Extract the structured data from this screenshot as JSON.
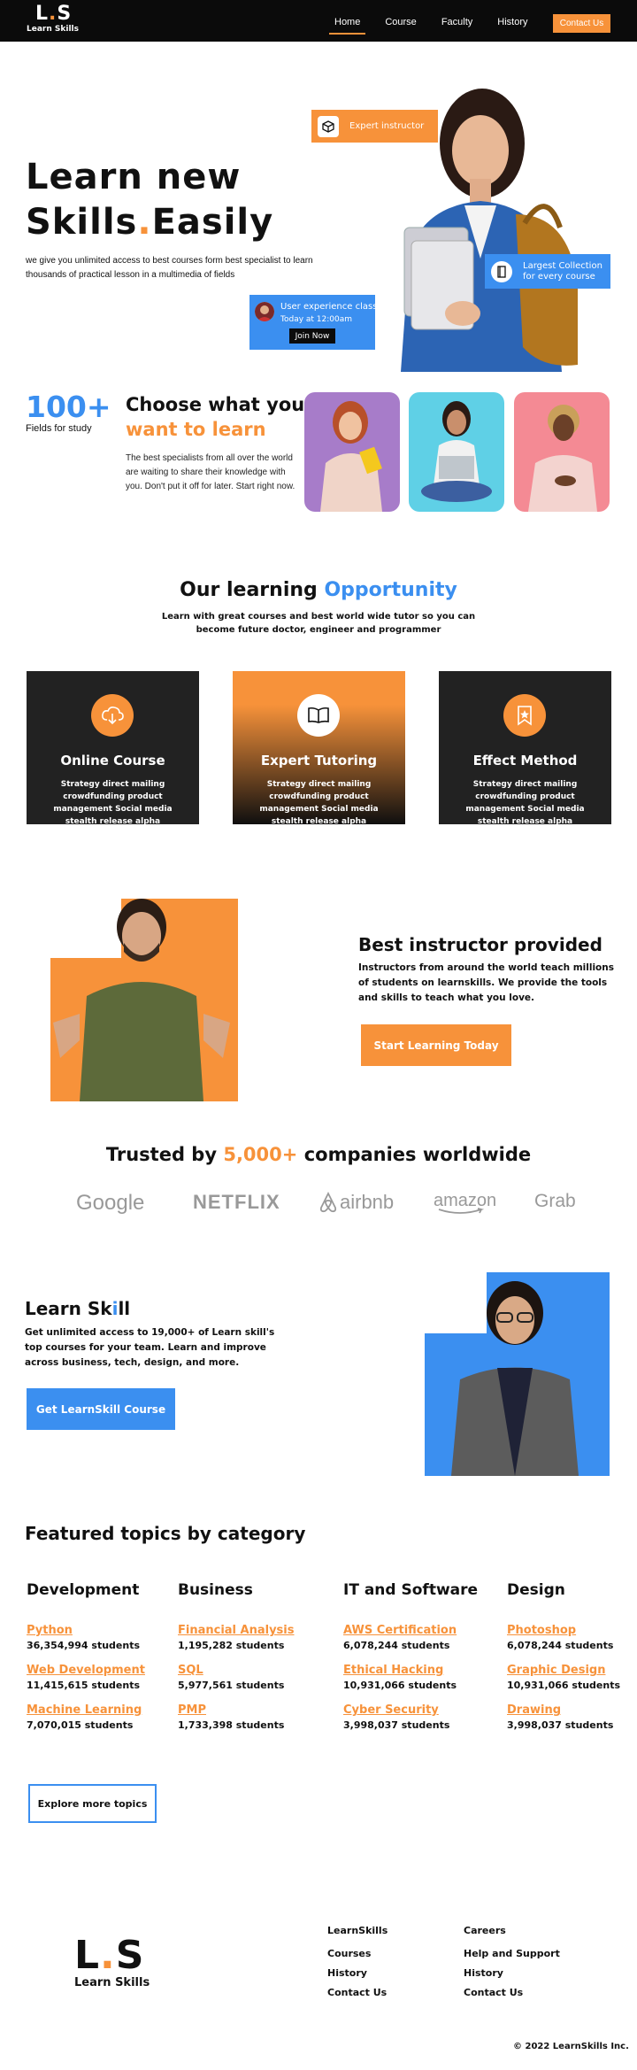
{
  "nav": {
    "logo_mark": "L",
    "logo_mark_end": "S",
    "logo_text": "Learn Skills",
    "links": [
      {
        "label": "Home",
        "active": true
      },
      {
        "label": "Course",
        "active": false
      },
      {
        "label": "Faculty",
        "active": false
      },
      {
        "label": "History",
        "active": false
      }
    ],
    "contact_label": "Contact Us"
  },
  "hero": {
    "title_line1": "Learn new",
    "title_word1": "Skills",
    "title_word2": "Easily",
    "description": "we give you unlimited access to best courses form best specialist to learn thousands of practical lesson in a multimedia of fields",
    "badge_expert": "Expert instructor",
    "badge_largest_line1": "Largest Collection",
    "badge_largest_line2": "for every course",
    "ux_title": "User experience class",
    "ux_time": "Today at 12:00am",
    "join_label": "Join Now"
  },
  "stats": {
    "number": "100+",
    "label": "Fields for study",
    "title_line1": "Choose what you",
    "title_line2": "want to learn",
    "description": "The best specialists from all over the world are waiting to share their knowledge with you. Don't put it off for later. Start right now."
  },
  "opportunity": {
    "title_a": "Our learning",
    "title_b": "Opportunity",
    "subtitle": "Learn with great courses and best world wide tutor so you can become future doctor, engineer and programmer",
    "cards": [
      {
        "title": "Online Course",
        "desc": "Strategy direct mailing crowdfunding product management Social media stealth release alpha"
      },
      {
        "title": "Expert Tutoring",
        "desc": "Strategy direct mailing crowdfunding product management Social media stealth release alpha"
      },
      {
        "title": "Effect Method",
        "desc": "Strategy direct mailing crowdfunding product management Social media stealth release alpha"
      }
    ]
  },
  "instructor": {
    "title": "Best instructor provided",
    "description": "Instructors from around the world teach millions of students on learnskills. We provide the tools and skills to teach what you love.",
    "button": "Start Learning Today"
  },
  "trusted": {
    "title_a": "Trusted by",
    "title_b": "5,000+",
    "title_c": "companies worldwide",
    "logos": [
      "Google",
      "NETFLIX",
      "airbnb",
      "amazon",
      "Grab"
    ]
  },
  "learnskill": {
    "title_a": "Learn Sk",
    "title_b": "i",
    "title_c": "ll",
    "description": "Get unlimited access to 19,000+ of Learn skill's top courses for your team. Learn and improve across business, tech, design, and more.",
    "button": "Get LearnSkill Course"
  },
  "featured": {
    "title": "Featured topics by category",
    "columns": [
      {
        "head": "Development",
        "topics": [
          {
            "name": "Python",
            "count": "36,354,994 students"
          },
          {
            "name": "Web Development",
            "count": "11,415,615 students"
          },
          {
            "name": "Machine Learning",
            "count": "7,070,015 students"
          }
        ]
      },
      {
        "head": "Business",
        "topics": [
          {
            "name": "Financial Analysis",
            "count": "1,195,282 students"
          },
          {
            "name": "SQL",
            "count": "5,977,561 students"
          },
          {
            "name": "PMP",
            "count": "1,733,398 students"
          }
        ]
      },
      {
        "head": "IT and Software",
        "topics": [
          {
            "name": "AWS Certification",
            "count": "6,078,244 students"
          },
          {
            "name": "Ethical Hacking",
            "count": "10,931,066 students"
          },
          {
            "name": "Cyber Security",
            "count": "3,998,037 students"
          }
        ]
      },
      {
        "head": "Design",
        "topics": [
          {
            "name": "Photoshop",
            "count": "6,078,244 students"
          },
          {
            "name": "Graphic Design",
            "count": "10,931,066 students"
          },
          {
            "name": "Drawing",
            "count": "3,998,037 students"
          }
        ]
      }
    ],
    "explore": "Explore more topics"
  },
  "footer": {
    "col1": [
      "LearnSkills",
      "Courses",
      "History",
      "Contact Us"
    ],
    "col2": [
      "Careers",
      "Help and Support",
      "History",
      "Contact Us"
    ],
    "copyright": "© 2022 LearnSkills Inc."
  },
  "colors": {
    "accent": "#f7923a",
    "brand_blue": "#3b8ff0",
    "dark": "#0b0b0b",
    "card_dark": "#222222"
  }
}
